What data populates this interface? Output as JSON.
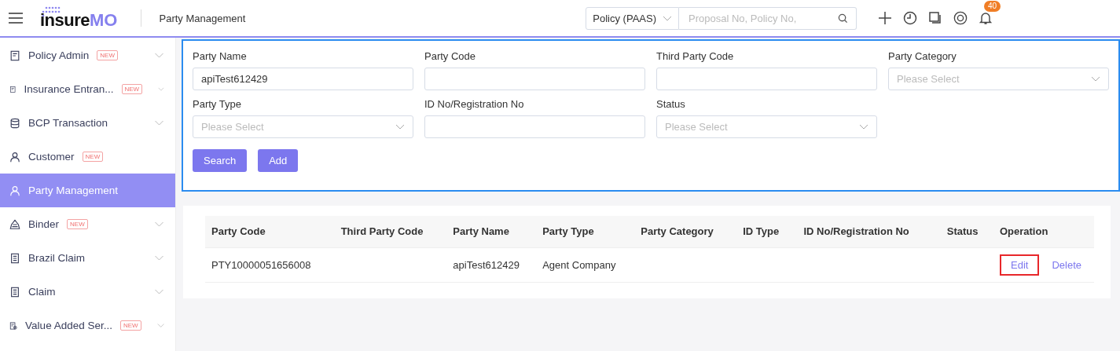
{
  "header": {
    "logo": {
      "dark": "insure",
      "accent": "MO"
    },
    "page_title": "Party Management",
    "scope_select": "Policy (PAAS)",
    "search": {
      "placeholder": "Proposal No, Policy No,"
    },
    "notification_count": "40"
  },
  "sidebar": {
    "items": [
      {
        "label": "Policy Admin",
        "new_badge": "NEW",
        "expandable": true,
        "selected": false
      },
      {
        "label": "Insurance Entran...",
        "new_badge": "NEW",
        "expandable": true,
        "selected": false
      },
      {
        "label": "BCP Transaction",
        "expandable": true,
        "selected": false
      },
      {
        "label": "Customer",
        "new_badge": "NEW",
        "expandable": false,
        "selected": false
      },
      {
        "label": "Party Management",
        "expandable": false,
        "selected": true
      },
      {
        "label": "Binder",
        "new_badge": "NEW",
        "expandable": true,
        "selected": false
      },
      {
        "label": "Brazil Claim",
        "expandable": true,
        "selected": false
      },
      {
        "label": "Claim",
        "expandable": true,
        "selected": false
      },
      {
        "label": "Value Added Ser...",
        "new_badge": "NEW",
        "expandable": true,
        "selected": false
      }
    ]
  },
  "search_form": {
    "highlighted": true,
    "fields": [
      {
        "label": "Party Name",
        "kind": "text",
        "value": "apiTest612429"
      },
      {
        "label": "Party Code",
        "kind": "text"
      },
      {
        "label": "Third Party Code",
        "kind": "text"
      },
      {
        "label": "Party Category",
        "kind": "select",
        "placeholder": "Please Select"
      },
      {
        "label": "Party Type",
        "kind": "select",
        "placeholder": "Please Select"
      },
      {
        "label": "ID No/Registration No",
        "kind": "text"
      },
      {
        "label": "Status",
        "kind": "select",
        "placeholder": "Please Select"
      }
    ],
    "buttons": [
      "Search",
      "Add"
    ]
  },
  "table": {
    "columns": [
      "Party Code",
      "Third Party Code",
      "Party Name",
      "Party Type",
      "Party Category",
      "ID Type",
      "ID No/Registration No",
      "Status",
      "Operation"
    ],
    "rows": [
      {
        "cells": [
          "PTY10000051656008",
          "",
          "apiTest612429",
          "Agent Company",
          "",
          "",
          "",
          ""
        ],
        "operations": [
          {
            "label": "Edit",
            "highlighted": true
          },
          {
            "label": "Delete",
            "highlighted": false
          }
        ]
      }
    ]
  }
}
